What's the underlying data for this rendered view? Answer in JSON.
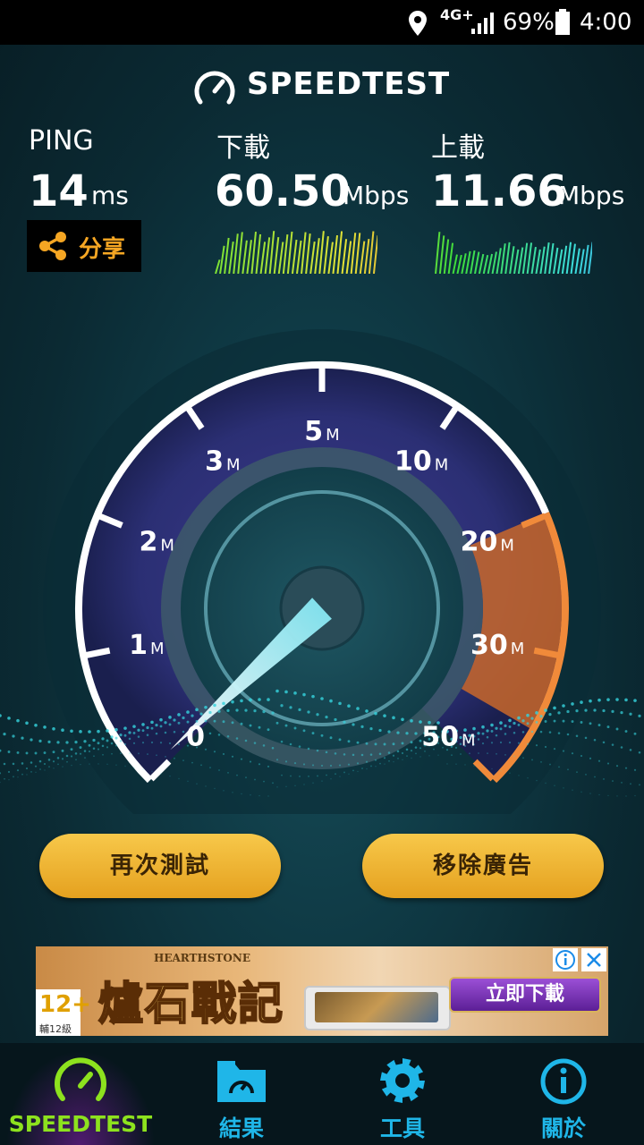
{
  "status_bar": {
    "network": "4G+",
    "battery_percent": "69%",
    "time": "4:00",
    "icons": [
      "location-icon",
      "signal-icon",
      "battery-icon"
    ]
  },
  "header": {
    "title": "SPEEDTEST",
    "trademark": "™"
  },
  "metrics": {
    "ping": {
      "label": "PING",
      "value": "14",
      "unit": "ms"
    },
    "download": {
      "label": "下載",
      "value": "60.50",
      "unit": "Mbps"
    },
    "upload": {
      "label": "上載",
      "value": "11.66",
      "unit": "Mbps"
    }
  },
  "share": {
    "label": "分享",
    "icon": "share-icon"
  },
  "gauge": {
    "labels": [
      {
        "num": "0",
        "unit": ""
      },
      {
        "num": "1",
        "unit": "M"
      },
      {
        "num": "2",
        "unit": "M"
      },
      {
        "num": "3",
        "unit": "M"
      },
      {
        "num": "5",
        "unit": "M"
      },
      {
        "num": "10",
        "unit": "M"
      },
      {
        "num": "20",
        "unit": "M"
      },
      {
        "num": "30",
        "unit": "M"
      },
      {
        "num": "50",
        "unit": "M"
      }
    ],
    "needle_value": "0"
  },
  "buttons": {
    "retest": "再次測試",
    "remove_ads": "移除廣告"
  },
  "ad": {
    "brand": "HEARTHSTONE",
    "title": "爐石戰記",
    "cta": "立即下載",
    "rating": "12+",
    "rating_note": "輔12級"
  },
  "nav": [
    {
      "label": "SPEEDTEST",
      "icon": "speedometer-icon",
      "active": true
    },
    {
      "label": "結果",
      "icon": "results-folder-icon",
      "active": false
    },
    {
      "label": "工具",
      "icon": "gear-icon",
      "active": false
    },
    {
      "label": "關於",
      "icon": "info-icon",
      "active": false
    }
  ],
  "colors": {
    "accent_orange": "#f5a623",
    "nav_active": "#8de21e",
    "nav_icon": "#1fb6e8",
    "button_gold": "#e5a11f"
  }
}
